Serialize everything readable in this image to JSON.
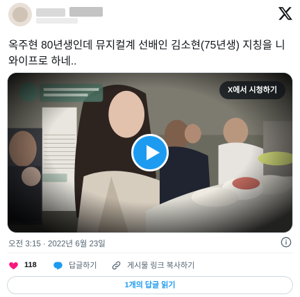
{
  "tweet": {
    "text": "옥주현 80년생인데 뮤지컬계 선배인 김소현(75년생) 지칭을 니와이프로 하네..",
    "timestamp": "오전 3:15 · 2022년 6월 23일"
  },
  "media": {
    "watch_label": "X에서 시청하기",
    "play_icon": "play-icon"
  },
  "actions": {
    "like_count": "118",
    "reply_label": "답글하기",
    "copy_label": "게시물 링크 복사하기"
  },
  "read_replies_label": "1개의 답글 읽기",
  "colors": {
    "accent": "#1d9bf0",
    "like": "#f91880",
    "muted": "#536471"
  }
}
